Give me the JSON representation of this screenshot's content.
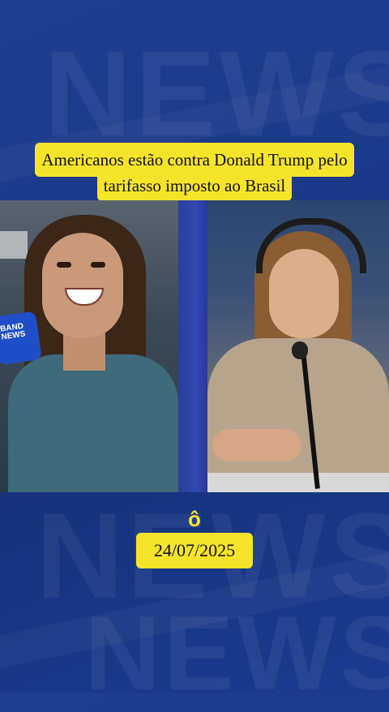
{
  "headline": {
    "line1": "Americanos estão contra Donald Trump pelo",
    "line2": "tarifasso imposto ao Brasil"
  },
  "background": {
    "watermark_word": "NEWS",
    "color": "#1a3a8a"
  },
  "mic_flag_text": "BAND NEWS",
  "separator_glyph": "ô",
  "date": "24/07/2025",
  "colors": {
    "caption_bg": "#f6e42a",
    "caption_text": "#111111"
  }
}
